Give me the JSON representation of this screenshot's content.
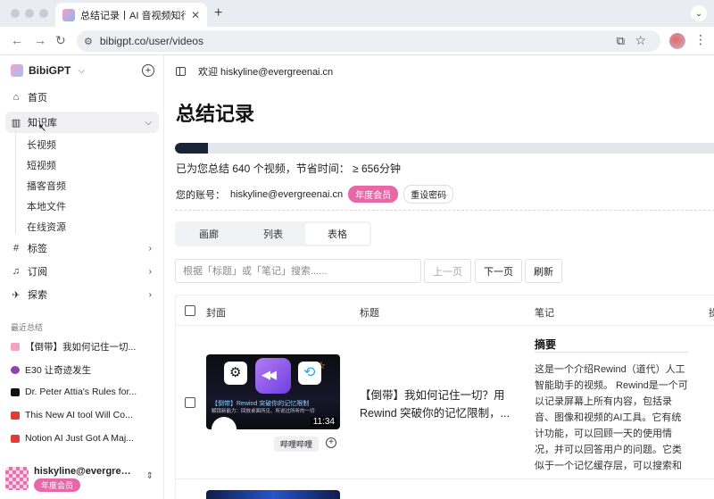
{
  "browser": {
    "tab_title": "总结记录丨AI 音视频知行助理",
    "url": "bibigpt.co/user/videos"
  },
  "sidebar": {
    "brand": "BibiGPT",
    "nav": [
      {
        "label": "首页",
        "icon": "home-icon"
      },
      {
        "label": "知识库",
        "icon": "library-icon"
      },
      {
        "label": "标签",
        "icon": "hash-icon"
      },
      {
        "label": "订阅",
        "icon": "bell-icon"
      },
      {
        "label": "探索",
        "icon": "telescope-icon"
      }
    ],
    "subitems": [
      "长视频",
      "短视频",
      "播客音频",
      "本地文件",
      "在线资源"
    ],
    "recent_label": "最近总结",
    "recent": [
      {
        "label": "【倒带】我如何记住一切...",
        "color": "#f4a3c2"
      },
      {
        "label": "E30 让奇迹发生",
        "color": "#8e44ad"
      },
      {
        "label": "Dr. Peter Attia's Rules for...",
        "color": "#111111"
      },
      {
        "label": "This New AI tool Will Co...",
        "color": "#e53935"
      },
      {
        "label": "Notion AI Just Got A Maj...",
        "color": "#e53935"
      }
    ],
    "user": {
      "name": "hiskyline@evergreenai.cn",
      "badge": "年度会员"
    }
  },
  "main": {
    "welcome": "欢迎 hiskyline@evergreenai.cn",
    "title": "总结记录",
    "progress": 0.06,
    "stats": "已为您总结 640 个视频，节省时间： ≥ 656分钟",
    "account_label": "您的账号：",
    "account_email": "hiskyline@evergreenai.cn",
    "member_badge": "年度会员",
    "reset_password": "重设密码",
    "view_tabs": [
      "画廊",
      "列表",
      "表格"
    ],
    "search_placeholder": "根据「标题」或「笔记」搜索......",
    "prev_page": "上一页",
    "next_page": "下一页",
    "refresh": "刷新",
    "columns": [
      "封面",
      "标题",
      "笔记",
      "操"
    ],
    "rows": [
      {
        "thumb_caption": "【倒带】Rewind 突破你的记忆限制",
        "thumb_subcaption": "解锁新能力：回放桌面所见、所说过所听的一切",
        "duration": "11:34",
        "source": "哔哩哔哩",
        "title": "【倒带】我如何记住一切？用 Rewind 突破你的记忆限制，...",
        "note_heading": "摘要",
        "note": "这是一个介绍Rewind（道代）人工智能助手的视频。 Rewind是一个可以记录屏幕上所有内容，包括录音、图像和视频的AI工具。它有统计功能，可以回顾一天的使用情况，并可以回答用户的问题。它类似于一个记忆缓存层，可以搜索和删除屏幕上显示的所有内容。另外，Rewind结合了应用程序和人工智"
      }
    ]
  }
}
